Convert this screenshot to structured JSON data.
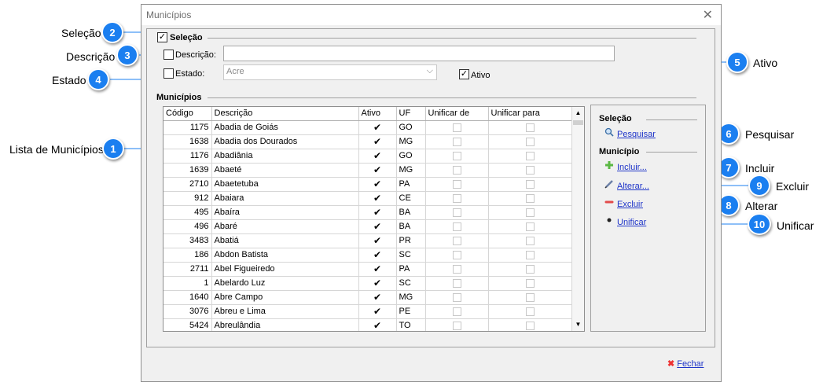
{
  "window": {
    "title": "Municípios",
    "close_icon": "close-icon"
  },
  "selection": {
    "title": "Seleção",
    "checked": true,
    "descricao_label": "Descrição:",
    "descricao_value": "",
    "estado_label": "Estado:",
    "estado_value": "Acre",
    "ativo_label": "Ativo",
    "ativo_checked": true
  },
  "grid": {
    "title": "Municípios",
    "columns": [
      "Código",
      "Descrição",
      "Ativo",
      "UF",
      "Unificar de",
      "Unificar para"
    ],
    "rows": [
      {
        "codigo": "1175",
        "descricao": "Abadia de Goiás",
        "ativo": true,
        "uf": "GO"
      },
      {
        "codigo": "1638",
        "descricao": "Abadia dos Dourados",
        "ativo": true,
        "uf": "MG"
      },
      {
        "codigo": "1176",
        "descricao": "Abadiânia",
        "ativo": true,
        "uf": "GO"
      },
      {
        "codigo": "1639",
        "descricao": "Abaeté",
        "ativo": true,
        "uf": "MG"
      },
      {
        "codigo": "2710",
        "descricao": "Abaetetuba",
        "ativo": true,
        "uf": "PA"
      },
      {
        "codigo": "912",
        "descricao": "Abaiara",
        "ativo": true,
        "uf": "CE"
      },
      {
        "codigo": "495",
        "descricao": "Abaíra",
        "ativo": true,
        "uf": "BA"
      },
      {
        "codigo": "496",
        "descricao": "Abaré",
        "ativo": true,
        "uf": "BA"
      },
      {
        "codigo": "3483",
        "descricao": "Abatiá",
        "ativo": true,
        "uf": "PR"
      },
      {
        "codigo": "186",
        "descricao": "Abdon Batista",
        "ativo": true,
        "uf": "SC"
      },
      {
        "codigo": "2711",
        "descricao": "Abel Figueiredo",
        "ativo": true,
        "uf": "PA"
      },
      {
        "codigo": "1",
        "descricao": "Abelardo Luz",
        "ativo": true,
        "uf": "SC"
      },
      {
        "codigo": "1640",
        "descricao": "Abre Campo",
        "ativo": true,
        "uf": "MG"
      },
      {
        "codigo": "3076",
        "descricao": "Abreu e Lima",
        "ativo": true,
        "uf": "PE"
      },
      {
        "codigo": "5424",
        "descricao": "Abreulândia",
        "ativo": true,
        "uf": "TO"
      }
    ]
  },
  "side_panel": {
    "selecao_title": "Seleção",
    "pesquisar": "Pesquisar",
    "municipio_title": "Município",
    "incluir": "Incluir...",
    "alterar": "Alterar...",
    "excluir": "Excluir",
    "unificar": "Unificar"
  },
  "footer": {
    "fechar": "Fechar"
  },
  "annotations": [
    {
      "num": "1",
      "label": "Lista de Municípios"
    },
    {
      "num": "2",
      "label": "Seleção"
    },
    {
      "num": "3",
      "label": "Descrição"
    },
    {
      "num": "4",
      "label": "Estado"
    },
    {
      "num": "5",
      "label": "Ativo"
    },
    {
      "num": "6",
      "label": "Pesquisar"
    },
    {
      "num": "7",
      "label": "Incluir"
    },
    {
      "num": "8",
      "label": "Alterar"
    },
    {
      "num": "9",
      "label": "Excluir"
    },
    {
      "num": "10",
      "label": "Unificar"
    }
  ],
  "colors": {
    "badge": "#1b7ff0",
    "link": "#1f35c9",
    "line": "#1b7ff0"
  }
}
